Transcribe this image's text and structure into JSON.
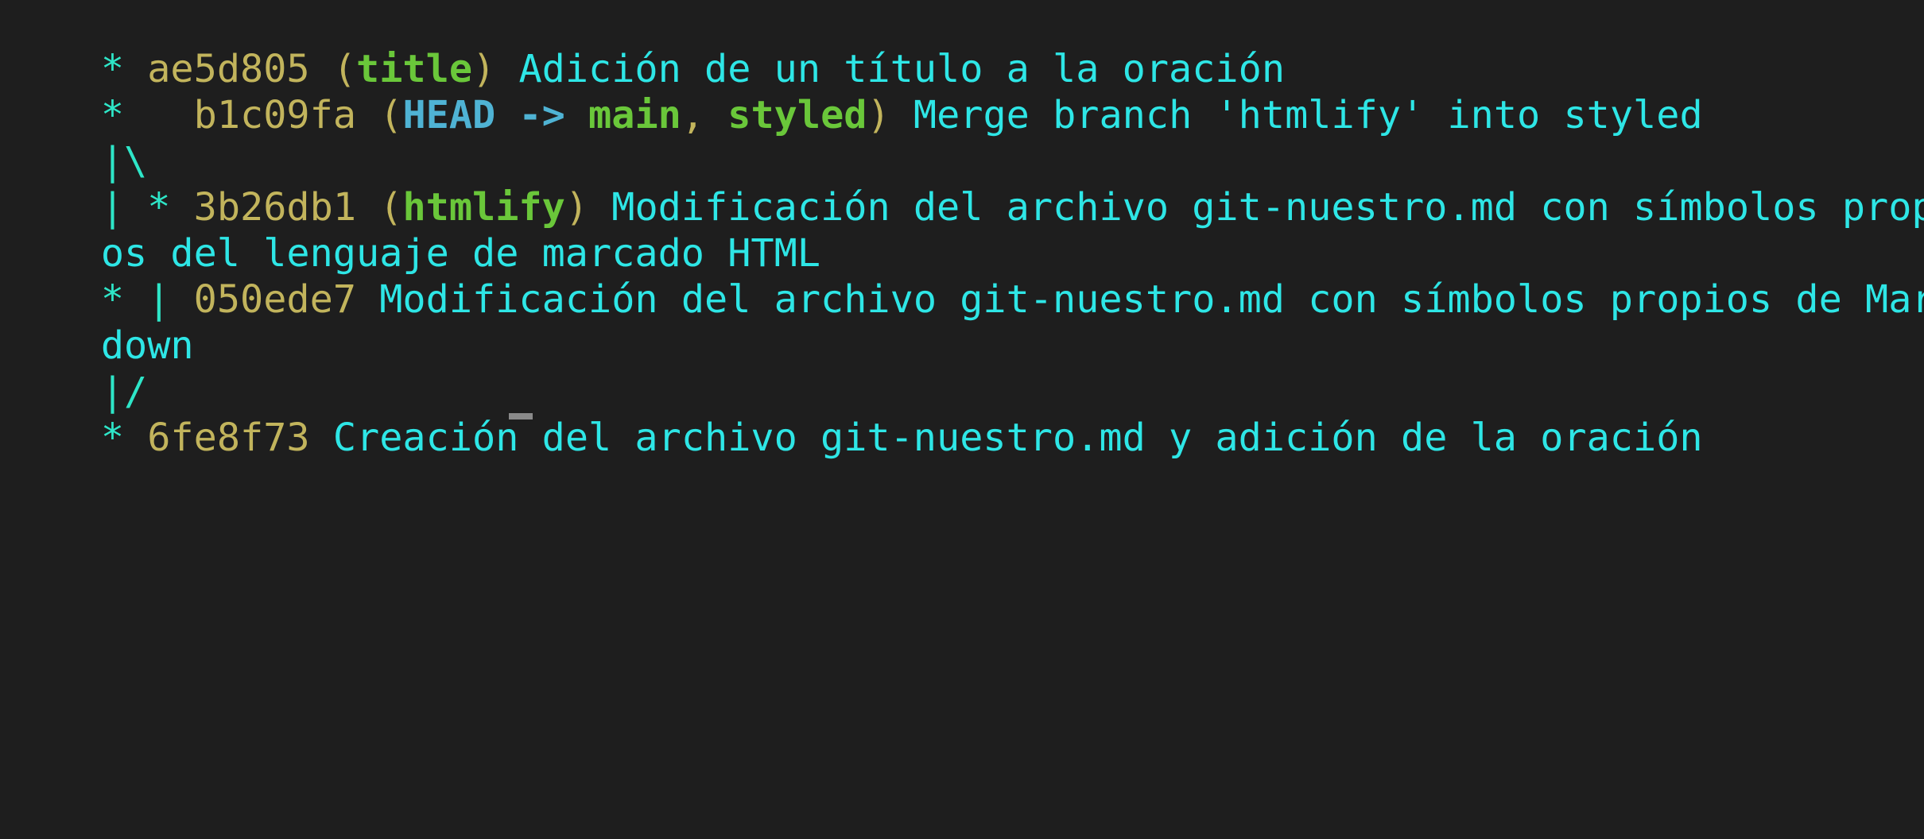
{
  "terminal": {
    "lines": [
      {
        "graph": "* ",
        "hash": "ae5d805",
        "open": " (",
        "ref1": "title",
        "close": ") ",
        "message": "Adición de un título a la oración"
      },
      {
        "graph": "*   ",
        "hash": "b1c09fa",
        "open": " (",
        "head": "HEAD -> ",
        "ref1": "main",
        "sep": ", ",
        "ref2": "styled",
        "close": ") ",
        "message": "Merge branch 'htmlify' into styled"
      },
      {
        "graph": "|\\"
      },
      {
        "graph": "| * ",
        "hash": "3b26db1",
        "open": " (",
        "ref1": "htmlify",
        "close": ") ",
        "message": "Modificación del archivo git-nuestro.md con símbolos propi"
      },
      {
        "message": "os del lenguaje de marcado HTML"
      },
      {
        "graph": "* | ",
        "hash": "050ede7",
        "message": " Modificación del archivo git-nuestro.md con símbolos propios de Mark"
      },
      {
        "message": "down"
      },
      {
        "graph": "|/"
      },
      {
        "graph": "* ",
        "hash": "6fe8f73",
        "message": " Creación del archivo git-nuestro.md y adición de la oración"
      }
    ]
  },
  "colors": {
    "background": "#1e1e1e",
    "graph": "#2ee6c8",
    "hash": "#c2b45c",
    "head": "#4fb3d4",
    "branch": "#6ac73a",
    "message": "#2ee6e6"
  }
}
